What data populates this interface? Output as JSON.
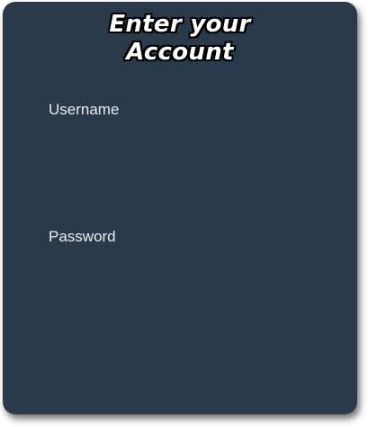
{
  "login": {
    "title_line1": "Enter your",
    "title_line2": "Account",
    "username_label": "Username",
    "username_value": "",
    "password_label": "Password",
    "password_value": ""
  },
  "colors": {
    "card_background": "#2a3a4a",
    "page_background": "#ffffff",
    "text": "#ffffff"
  }
}
